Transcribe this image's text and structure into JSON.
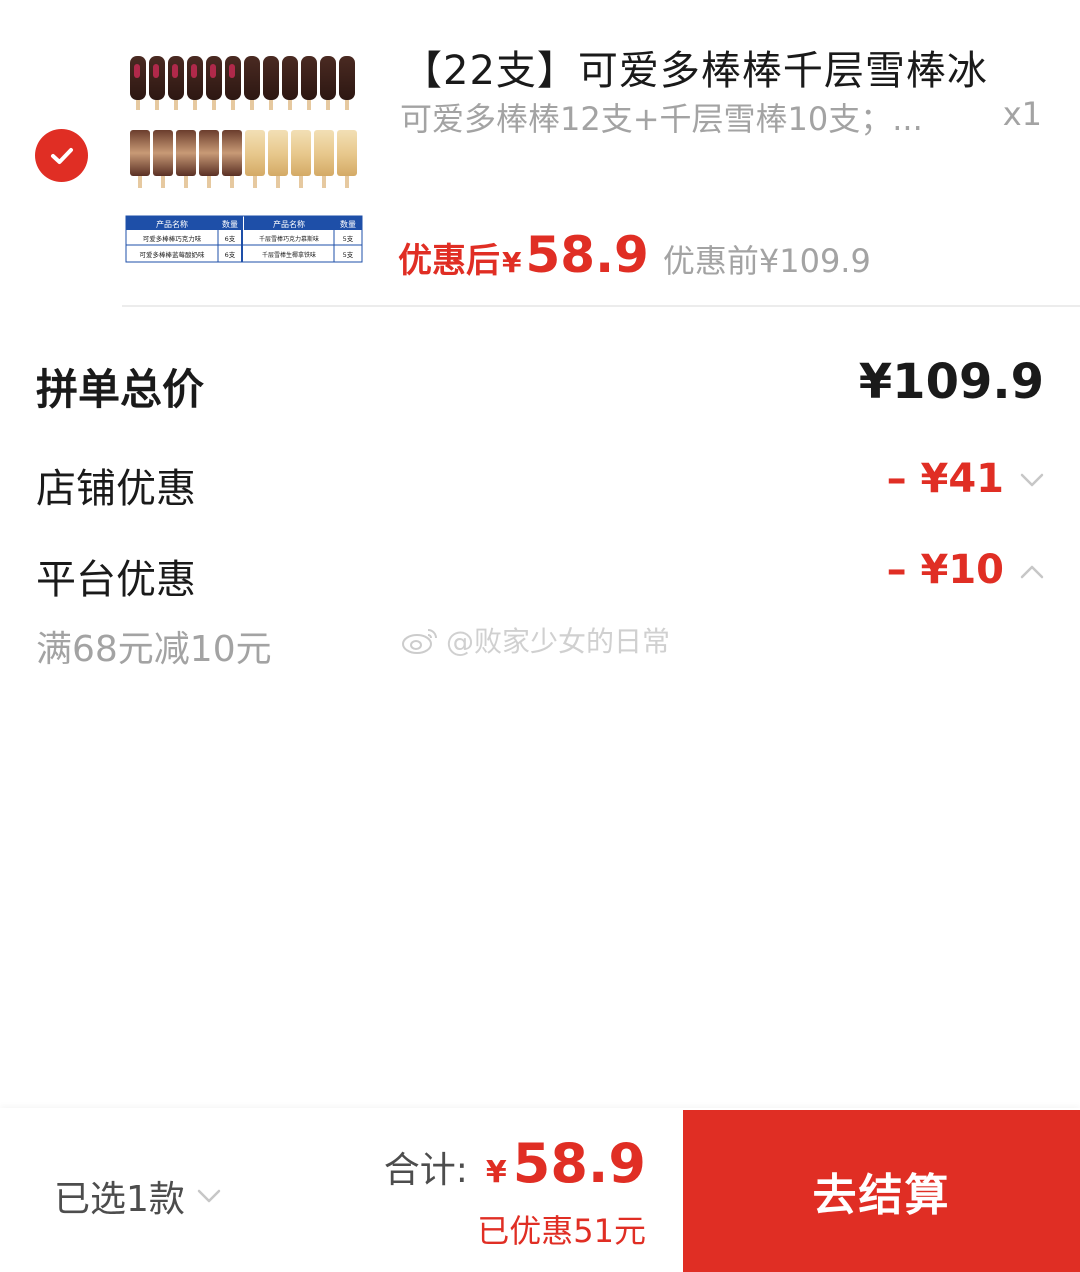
{
  "product": {
    "title": "【22支】可爱多棒棒千层雪棒冰",
    "spec": "可爱多棒棒12支+千层雪棒10支；...",
    "quantity": "x1",
    "after_label": "优惠后",
    "currency": "¥",
    "after_price": "58.9",
    "before_price_text": "优惠前¥109.9",
    "image_table": {
      "headers": [
        "产品名称",
        "数量",
        "产品名称",
        "数量"
      ],
      "rows": [
        [
          "可爱多棒棒巧克力味",
          "6支",
          "千层雪棒巧克力慕斯味",
          "5支"
        ],
        [
          "可爱多棒棒蓝莓酸奶味",
          "6支",
          "千层雪棒生椰拿铁味",
          "5支"
        ]
      ]
    }
  },
  "summary": {
    "total_label": "拼单总价",
    "total_value": "¥109.9",
    "shop_label": "店铺优惠",
    "shop_value": "– ¥41",
    "platform_label": "平台优惠",
    "platform_value": "– ¥10",
    "platform_rule": "满68元减10元"
  },
  "watermark": "@败家少女的日常",
  "bottom": {
    "selected": "已选1款",
    "sum_label": "合计:",
    "currency": "¥",
    "sum_value": "58.9",
    "saved": "已优惠51元",
    "checkout": "去结算"
  },
  "colors": {
    "accent": "#e02e24",
    "muted": "#a3a3a3",
    "text": "#1a1a1a"
  },
  "icons": [
    "check-icon",
    "chevron-down-icon",
    "chevron-up-icon",
    "weibo-icon"
  ]
}
